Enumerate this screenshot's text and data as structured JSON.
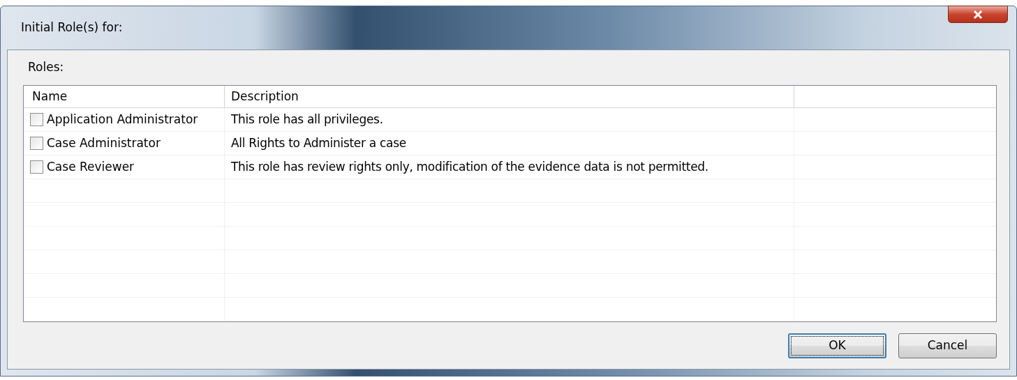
{
  "window": {
    "title": "Initial Role(s) for:"
  },
  "roles_label": "Roles:",
  "table": {
    "columns": [
      "Name",
      "Description"
    ],
    "rows": [
      {
        "name": "Application Administrator",
        "description": "This role has all privileges.",
        "checked": false
      },
      {
        "name": "Case Administrator",
        "description": "All Rights to Administer a case",
        "checked": false
      },
      {
        "name": "Case Reviewer",
        "description": "This role has review rights only, modification of the evidence data is not permitted.",
        "checked": false
      }
    ]
  },
  "buttons": [
    {
      "label": "OK",
      "default": true
    },
    {
      "label": "Cancel",
      "default": false
    }
  ]
}
